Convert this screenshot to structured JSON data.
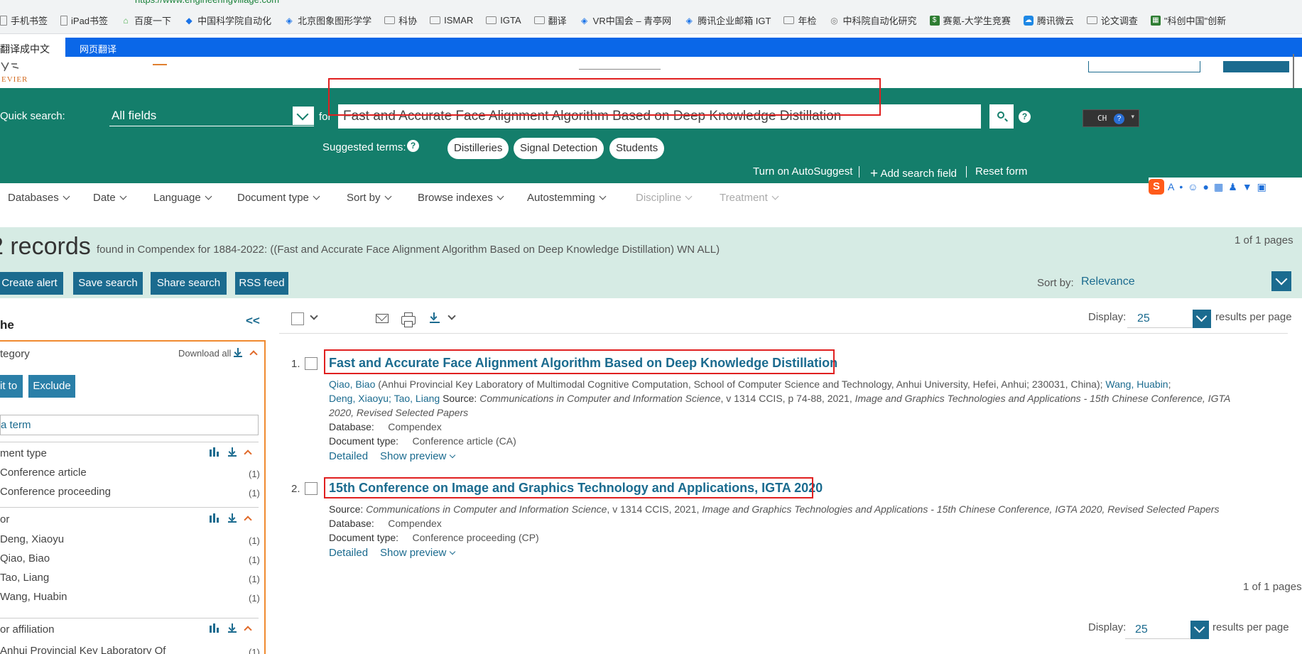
{
  "bookmarks": [
    {
      "label": "手机书签",
      "icon": "page-icon"
    },
    {
      "label": "iPad书签",
      "icon": "page-icon"
    },
    {
      "label": "百度一下",
      "icon": "house-icon"
    },
    {
      "label": "中国科学院自动化",
      "icon": "diamond-icon"
    },
    {
      "label": "北京图象图形学学",
      "icon": "site-icon"
    },
    {
      "label": "科协",
      "icon": "folder-icon"
    },
    {
      "label": "ISMAR",
      "icon": "folder-icon"
    },
    {
      "label": "IGTA",
      "icon": "folder-icon"
    },
    {
      "label": "翻译",
      "icon": "folder-icon"
    },
    {
      "label": "VR中国会 – 青亭网",
      "icon": "site-icon"
    },
    {
      "label": "腾讯企业邮箱 IGT",
      "icon": "site-icon"
    },
    {
      "label": "年检",
      "icon": "folder-icon"
    },
    {
      "label": "中科院自动化研究",
      "icon": "globe-icon"
    },
    {
      "label": "赛氪-大学生竞赛",
      "icon": "dollar-icon"
    },
    {
      "label": "腾讯微云",
      "icon": "cloud-icon"
    },
    {
      "label": "论文调查",
      "icon": "folder-icon"
    },
    {
      "label": "\"科创中国\"创新",
      "icon": "grid-icon"
    }
  ],
  "translate": {
    "label": "翻译成中文",
    "button": "网页翻译"
  },
  "header": {
    "logo_text": "EVIER"
  },
  "search": {
    "quick_label": "Quick search:",
    "field": "All fields",
    "for_label": "for",
    "query": "Fast and Accurate Face Alignment Algorithm Based on Deep Knowledge Distillation",
    "suggested_label": "Suggested terms:",
    "suggested": [
      "Distilleries",
      "Signal Detection",
      "Students"
    ],
    "links": {
      "autosuggest": "Turn on AutoSuggest",
      "add_field": "Add search field",
      "reset": "Reset form"
    },
    "lang_widget": "CH"
  },
  "filters": [
    "Databases",
    "Date",
    "Language",
    "Document type",
    "Sort by",
    "Browse indexes",
    "Autostemming",
    "Discipline",
    "Treatment"
  ],
  "results_header": {
    "count": "2 records",
    "info": "found in Compendex for 1884-2022: ((Fast and Accurate Face Alignment Algorithm Based on Deep Knowledge Distillation) WN ALL)",
    "pages": "1 of 1 pages",
    "actions": [
      "Create alert",
      "Save search",
      "Share search",
      "RSS feed"
    ],
    "sort_label": "Sort by:",
    "sort_value": "Relevance"
  },
  "sidebar": {
    "title": "he",
    "collapse": "<<",
    "category": "tegory",
    "download_all": "Download all",
    "limit_btn": "it to",
    "exclude_btn": "Exclude",
    "term_placeholder": "a term",
    "sections": [
      {
        "title": "ment type",
        "items": [
          {
            "label": "Conference article",
            "count": "(1)"
          },
          {
            "label": "Conference proceeding",
            "count": "(1)"
          }
        ]
      },
      {
        "title": "or",
        "items": [
          {
            "label": "Deng, Xiaoyu",
            "count": "(1)"
          },
          {
            "label": "Qiao, Biao",
            "count": "(1)"
          },
          {
            "label": "Tao, Liang",
            "count": "(1)"
          },
          {
            "label": "Wang, Huabin",
            "count": "(1)"
          }
        ]
      },
      {
        "title": "or affiliation",
        "items": [
          {
            "label": "Anhui Provincial Key Laboratory Of",
            "count": "(1)"
          }
        ]
      }
    ]
  },
  "toolbar": {
    "display_label": "Display:",
    "display_value": "25",
    "per_page": "results per page"
  },
  "results": [
    {
      "num": "1.",
      "title": "Fast and Accurate Face Alignment Algorithm Based on Deep Knowledge Distillation",
      "line1_author": "Qiao, Biao",
      "line1_text": "(Anhui Provincial Key Laboratory of Multimodal Cognitive Computation, School of Computer Science and Technology, Anhui University, Hefei, Anhui; 230031, China);",
      "line1_author2": "Wang, Huabin",
      "line2_authors": "Deng, Xiaoyu; Tao, Liang",
      "source_label": "Source:",
      "line2_source": "Communications in Computer and Information Science",
      "line2_detail": ", v 1314 CCIS, p 74-88, 2021,",
      "line2_conf": "Image and Graphics Technologies and Applications - 15th Chinese Conference, IGTA",
      "line3": "2020, Revised Selected Papers",
      "db_label": "Database:",
      "db": "Compendex",
      "type_label": "Document type:",
      "type": "Conference article (CA)",
      "detailed": "Detailed",
      "preview": "Show preview"
    },
    {
      "num": "2.",
      "title": "15th Conference on Image and Graphics Technology and Applications, IGTA 2020",
      "source_label": "Source:",
      "source": "Communications in Computer and Information Science",
      "source_detail": ", v 1314 CCIS, 2021,",
      "source_conf": "Image and Graphics Technologies and Applications - 15th Chinese Conference, IGTA 2020, Revised Selected Papers",
      "db_label": "Database:",
      "db": "Compendex",
      "type_label": "Document type:",
      "type": "Conference proceeding (CP)",
      "detailed": "Detailed",
      "preview": "Show preview"
    }
  ],
  "footer": {
    "pages": "1 of 1 pages"
  }
}
